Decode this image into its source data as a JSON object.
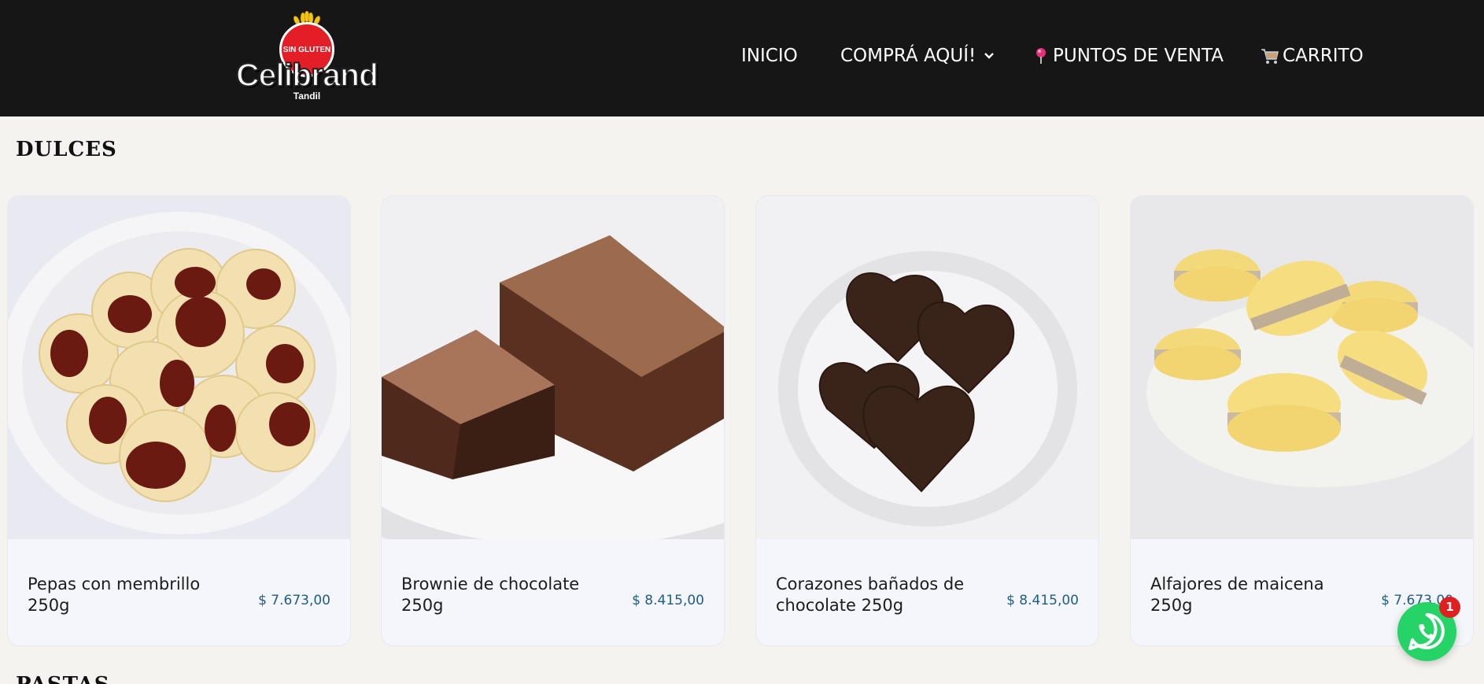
{
  "brand": {
    "name": "Celibrand",
    "sublabel": "Tandil",
    "badge_text": "SIN GLUTEN"
  },
  "nav": {
    "inicio": "INICIO",
    "compra": "COMPRÁ AQUÍ!",
    "puntos": "PUNTOS DE VENTA",
    "carrito": "CARRITO"
  },
  "sections": {
    "dulces": "DULCES",
    "pastas": "PASTAS"
  },
  "products": [
    {
      "name": "Pepas con membrillo 250g",
      "price": "$ 7.673,00"
    },
    {
      "name": "Brownie de chocolate 250g",
      "price": "$ 8.415,00"
    },
    {
      "name": "Corazones bañados de chocolate 250g",
      "price": "$ 8.415,00"
    },
    {
      "name": "Alfajores de maicena 250g",
      "price": "$ 7.673,00"
    }
  ],
  "whatsapp": {
    "icon": "whatsapp-icon",
    "badge_count": "1"
  },
  "colors": {
    "header_bg": "#161616",
    "page_bg": "#f4f3ef",
    "price": "#1f5c86",
    "whatsapp": "#25d366",
    "badge": "#e0201f"
  }
}
